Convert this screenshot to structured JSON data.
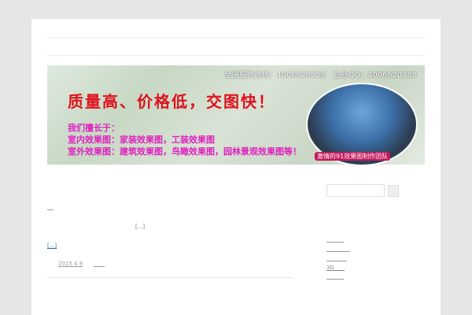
{
  "banner": {
    "hotline": "全国服务热线：4006620358",
    "qq": "企业QQ：4006620358",
    "slogan": "质量高、价格低，交图快！",
    "lines": [
      "我们擅长于：",
      "室内效果图：家装效果图，工装效果图",
      "室外效果图：建筑效果图，鸟瞰效果图，园林景观效果图等！"
    ],
    "team_caption": "激情的91效果图制作团队"
  },
  "post": {
    "excerpt_more": "[...]",
    "read_more": "[...]",
    "date": "2015 4 8"
  },
  "sidebar": {
    "links": [
      "",
      "",
      "",
      "3D",
      ""
    ]
  }
}
